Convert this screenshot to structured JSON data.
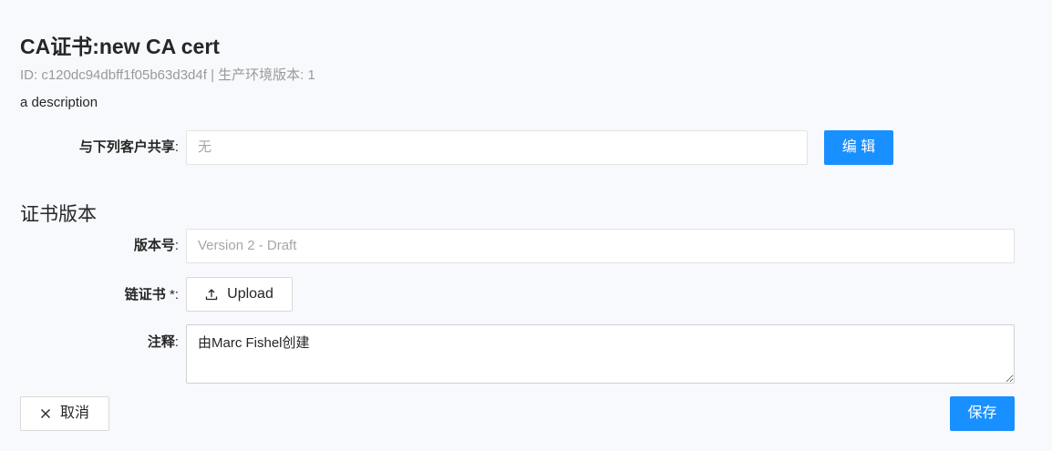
{
  "header": {
    "title": "CA证书:new CA cert",
    "meta": "ID: c120dc94dbff1f05b63d3d4f | 生产环境版本: 1",
    "description": "a description"
  },
  "share": {
    "label": "与下列客户共享",
    "colon": ":",
    "value": "无",
    "edit_button": "编 辑"
  },
  "versions": {
    "section_title": "证书版本",
    "version_label": "版本号",
    "version_value": "Version 2 - Draft",
    "chain_label": "链证书",
    "chain_required": "*:",
    "upload_button": "Upload",
    "notes_label": "注释",
    "notes_value": "由Marc Fishel创建"
  },
  "footer": {
    "cancel_button": "取消",
    "save_button": "保存"
  },
  "colors": {
    "primary": "#1890ff",
    "background": "#f8f9fc"
  },
  "icons": {
    "upload": "upload-icon",
    "close": "close-icon"
  }
}
